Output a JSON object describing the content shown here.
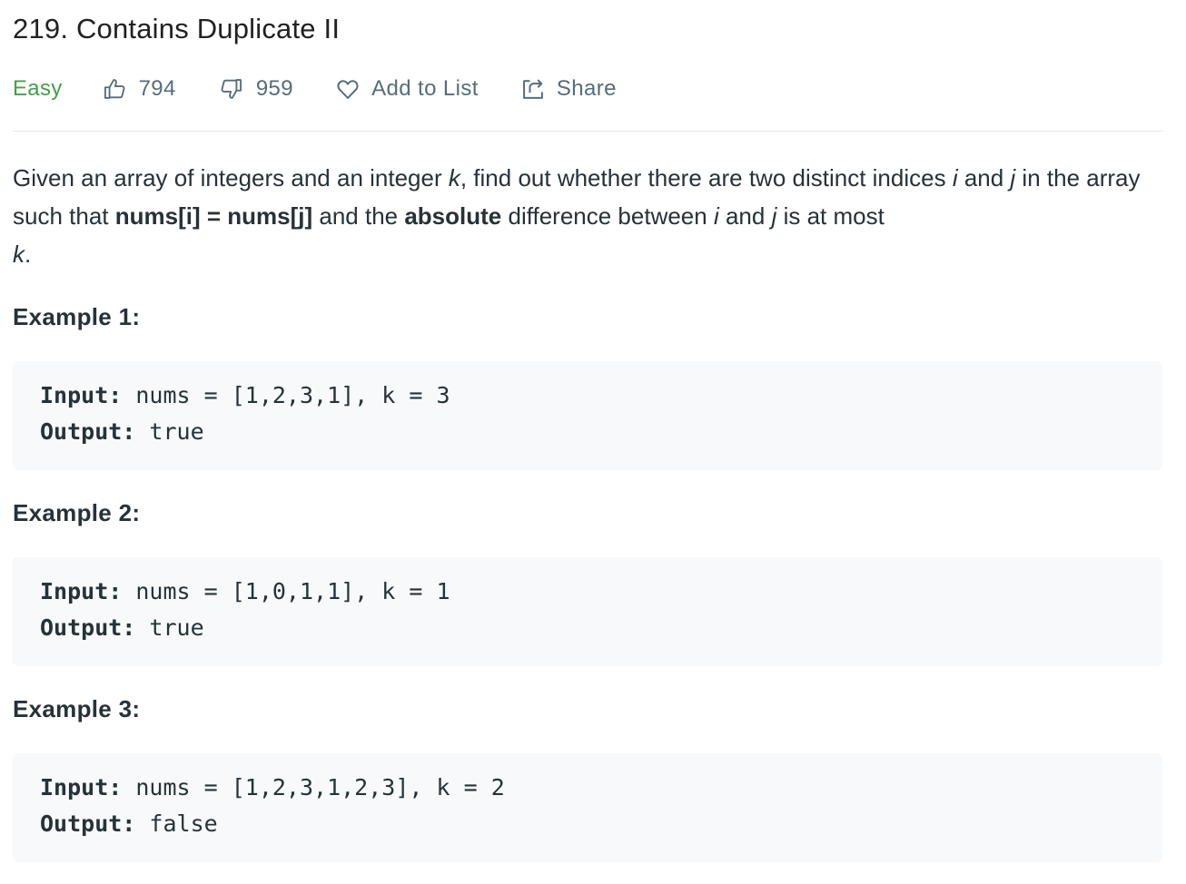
{
  "problem": {
    "title": "219. Contains Duplicate II",
    "difficulty": "Easy",
    "likes": "794",
    "dislikes": "959",
    "add_to_list": "Add to List",
    "share": "Share"
  },
  "description": {
    "p1": "Given an array of integers and an integer ",
    "k1": "k",
    "p2": ", find out whether there are two distinct indices ",
    "i1": "i",
    "p3": " and ",
    "j1": "j",
    "p4": " in the array such that ",
    "b1": "nums[i] = nums[j]",
    "p5": " and the ",
    "b2": "absolute",
    "p6": " difference between ",
    "i2": "i",
    "p7": " and ",
    "j2": "j",
    "p8": " is at most ",
    "k2": "k",
    "p9": "."
  },
  "examples": [
    {
      "title": "Example 1:",
      "input_label": "Input:",
      "input": " nums = [1,2,3,1], k = 3",
      "output_label": "Output:",
      "output": " true"
    },
    {
      "title": "Example 2:",
      "input_label": "Input:",
      "input": " nums = [1,0,1,1], k = 1",
      "output_label": "Output:",
      "output": " true"
    },
    {
      "title": "Example 3:",
      "input_label": "Input:",
      "input": " nums = [1,2,3,1,2,3], k = 2",
      "output_label": "Output:",
      "output": " false"
    }
  ],
  "icons": {
    "like": "thumbs-up-icon",
    "dislike": "thumbs-down-icon",
    "add": "heart-icon",
    "share": "share-icon"
  },
  "colors": {
    "easy": "#43a047",
    "meta_text": "#546e7a",
    "code_bg": "#f7f9fa"
  }
}
